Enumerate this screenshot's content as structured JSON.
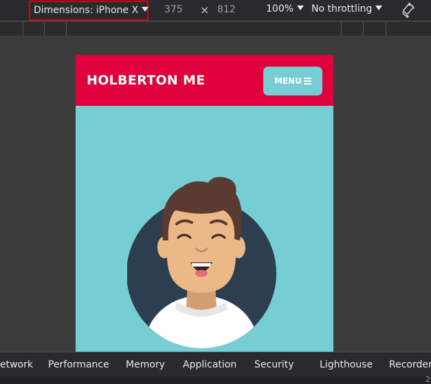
{
  "toolbar": {
    "dimensions_label": "Dimensions: iPhone X",
    "width": "375",
    "times": "×",
    "height": "812",
    "zoom": "100%",
    "throttling": "No throttling",
    "rotate_icon": "rotate-icon"
  },
  "page": {
    "brand": "HOLBERTON ME",
    "menu_label": "MENU",
    "menu_icon": "hamburger-icon",
    "header_color": "#e0003c",
    "accent_color": "#76cdd3",
    "avatar_bg_color": "#2d3e50"
  },
  "tabs": [
    "etwork",
    "Performance",
    "Memory",
    "Application",
    "Security",
    "Lighthouse",
    "Recorder"
  ],
  "status": {
    "mark": "2"
  }
}
